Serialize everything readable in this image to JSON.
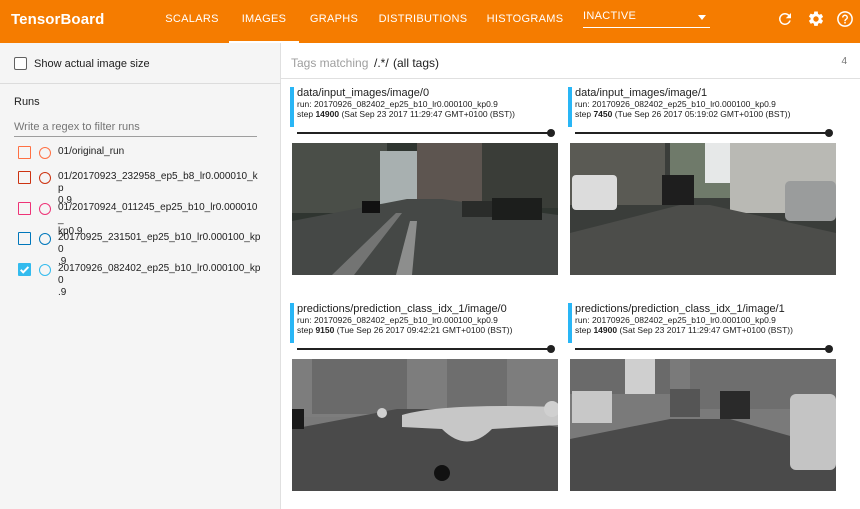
{
  "header": {
    "brand": "TensorBoard",
    "tabs": [
      "SCALARS",
      "IMAGES",
      "GRAPHS",
      "DISTRIBUTIONS",
      "HISTOGRAMS"
    ],
    "active_tab": "IMAGES",
    "inactive_select": "INACTIVE",
    "icons": [
      "refresh-icon",
      "settings-icon",
      "help-icon"
    ]
  },
  "sidebar": {
    "show_actual_size": "Show actual image size",
    "runs_title": "Runs",
    "filter_placeholder": "Write a regex to filter runs",
    "runs": [
      {
        "line1": "01/original_run",
        "line2": "",
        "color": "#ff7043",
        "checked": false
      },
      {
        "line1": "01/20170923_232958_ep5_b8_lr0.000010_kp",
        "line2": "0.9",
        "color": "#cc3311",
        "checked": false
      },
      {
        "line1": "01/20170924_011245_ep25_b10_lr0.000010_",
        "line2": "kp0.9",
        "color": "#ee3377",
        "checked": false
      },
      {
        "line1": "20170925_231501_ep25_b10_lr0.000100_kp0",
        "line2": ".9",
        "color": "#0077bb",
        "checked": false
      },
      {
        "line1": "20170926_082402_ep25_b10_lr0.000100_kp0",
        "line2": ".9",
        "color": "#33bbee",
        "checked": true
      }
    ]
  },
  "tags": {
    "label": "Tags matching",
    "regex": "/.*/",
    "all": "(all tags)",
    "count": "4"
  },
  "cards": [
    {
      "title": "data/input_images/image/0",
      "run": "run: 20170926_082402_ep25_b10_lr0.000100_kp0.9",
      "step_label": "step",
      "step": "14900",
      "time": "(Sat Sep 23 2017 11:29:47 GMT+0100 (BST))",
      "slider": 1.0
    },
    {
      "title": "data/input_images/image/1",
      "run": "run: 20170926_082402_ep25_b10_lr0.000100_kp0.9",
      "step_label": "step",
      "step": "7450",
      "time": "(Tue Sep 26 2017 05:19:02 GMT+0100 (BST))",
      "slider": 1.0
    },
    {
      "title": "predictions/prediction_class_idx_1/image/0",
      "run": "run: 20170926_082402_ep25_b10_lr0.000100_kp0.9",
      "step_label": "step",
      "step": "9150",
      "time": "(Tue Sep 26 2017 09:42:21 GMT+0100 (BST))",
      "slider": 1.0
    },
    {
      "title": "predictions/prediction_class_idx_1/image/1",
      "run": "run: 20170926_082402_ep25_b10_lr0.000100_kp0.9",
      "step_label": "step",
      "step": "14900",
      "time": "(Sat Sep 23 2017 11:29:47 GMT+0100 (BST))",
      "slider": 1.0
    }
  ]
}
